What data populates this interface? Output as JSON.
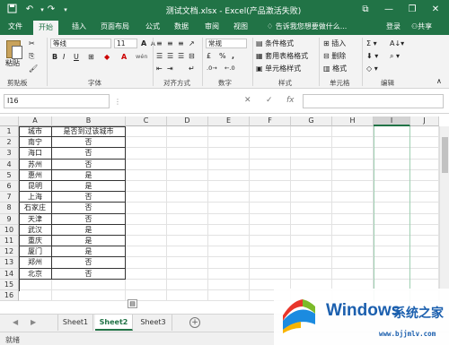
{
  "titlebar": {
    "title": "测试文档.xlsx - Excel(产品激活失败)",
    "undo_icon": "undo-icon",
    "redo_icon": "redo-icon",
    "minimize": "—",
    "restore": "❐",
    "close": "✕",
    "ribbon_toggle": "⧉",
    "bg_color": "#217346"
  },
  "menu": {
    "tabs": [
      "文件",
      "开始",
      "插入",
      "页面布局",
      "公式",
      "数据",
      "审阅",
      "视图"
    ],
    "active_tab": "开始",
    "tell_me": "告诉我您想要做什么...",
    "login": "登录",
    "share": "共享"
  },
  "ribbon": {
    "paste_label": "粘贴",
    "font_name": "等线",
    "font_size": "11",
    "number_format": "常规",
    "bold": "B",
    "italic": "I",
    "underline": "U",
    "font_a_large": "A",
    "font_a_small": "A",
    "wen": "wén",
    "percent": "%",
    "comma": ",",
    "currency": "£",
    "cond_format": "条件格式",
    "table_format": "套用表格格式",
    "cell_style": "单元格样式",
    "insert": "插入",
    "delete": "删除",
    "format": "格式",
    "groups": [
      "剪贴板",
      "字体",
      "对齐方式",
      "数字",
      "样式",
      "单元格",
      "编辑"
    ]
  },
  "formula_bar": {
    "name_box": "I16",
    "fx": "fx",
    "cancel": "✕",
    "enter": "✓",
    "value": ""
  },
  "grid": {
    "columns": [
      "A",
      "B",
      "C",
      "D",
      "E",
      "F",
      "G",
      "H",
      "I",
      "J"
    ],
    "selected_column": "I",
    "row_numbers": [
      "1",
      "2",
      "3",
      "4",
      "5",
      "6",
      "7",
      "8",
      "9",
      "10",
      "11",
      "12",
      "13",
      "14",
      "15",
      "16"
    ],
    "rows": [
      [
        "城市",
        "是否到过该城市"
      ],
      [
        "南宁",
        "否"
      ],
      [
        "海口",
        "否"
      ],
      [
        "苏州",
        "否"
      ],
      [
        "惠州",
        "是"
      ],
      [
        "昆明",
        "是"
      ],
      [
        "上海",
        "否"
      ],
      [
        "石家庄",
        "否"
      ],
      [
        "天津",
        "否"
      ],
      [
        "武汉",
        "是"
      ],
      [
        "重庆",
        "是"
      ],
      [
        "厦门",
        "是"
      ],
      [
        "郑州",
        "否"
      ],
      [
        "北京",
        "否"
      ]
    ]
  },
  "sheets": {
    "tabs": [
      "Sheet1",
      "Sheet2",
      "Sheet3"
    ],
    "active": "Sheet2",
    "add": "+"
  },
  "status": {
    "text": "就绪"
  },
  "watermark": {
    "word": "Windows",
    "cn": "系统之家",
    "url": "www.bjjmlv.com"
  }
}
